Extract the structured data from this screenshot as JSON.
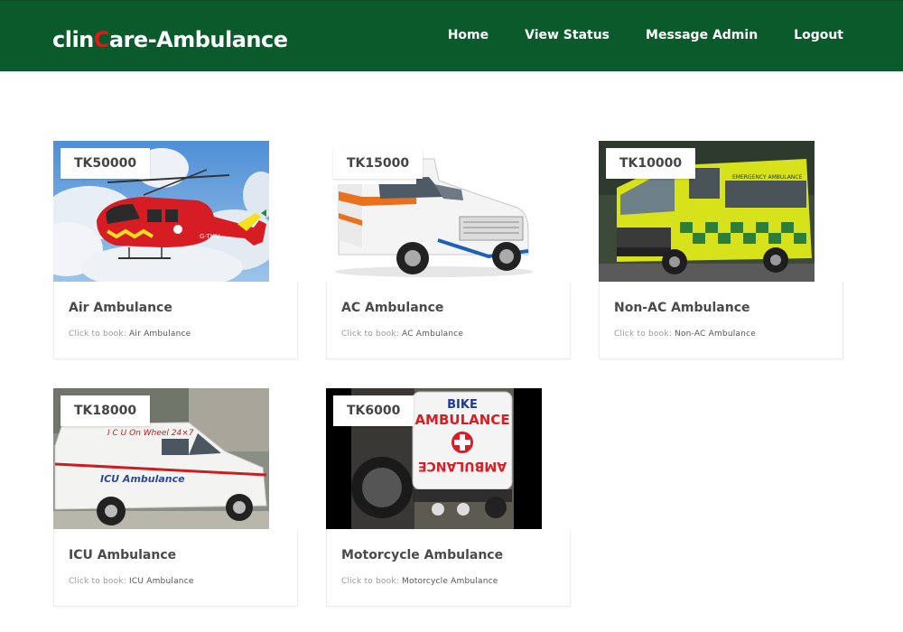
{
  "brand": {
    "prefix": "clin",
    "accent_letter": "C",
    "suffix": "are-Ambulance"
  },
  "nav": [
    "Home",
    "View Status",
    "Message Admin",
    "Logout"
  ],
  "book_prefix": "Click to book: ",
  "cards": [
    {
      "price": "TK50000",
      "title": "Air Ambulance",
      "book_value": "Air Ambulance",
      "image": "helicopter"
    },
    {
      "price": "TK15000",
      "title": "AC Ambulance",
      "book_value": "AC Ambulance",
      "image": "white-suv-ambulance"
    },
    {
      "price": "TK10000",
      "title": "Non-AC Ambulance",
      "book_value": "Non-AC Ambulance",
      "image": "yellow-van-ambulance"
    },
    {
      "price": "TK18000",
      "title": "ICU Ambulance",
      "book_value": "ICU Ambulance",
      "image": "white-icu-van"
    },
    {
      "price": "TK6000",
      "title": "Motorcycle Ambulance",
      "book_value": "Motorcycle Ambulance",
      "image": "bike-ambulance"
    }
  ],
  "image_text": {
    "bike_line1": "BIKE",
    "bike_line2": "AMBULANCE",
    "bike_mirror": "AMBULANCE",
    "icu_side": "ICU Ambulance",
    "icu_top": "I C U On Wheel 24×7",
    "heli_reg": "G-TVAI",
    "yellow_top": "EMERGENCY AMBULANCE"
  },
  "colors": {
    "navbar": "#0b5a2b",
    "accent": "#e8141a"
  }
}
